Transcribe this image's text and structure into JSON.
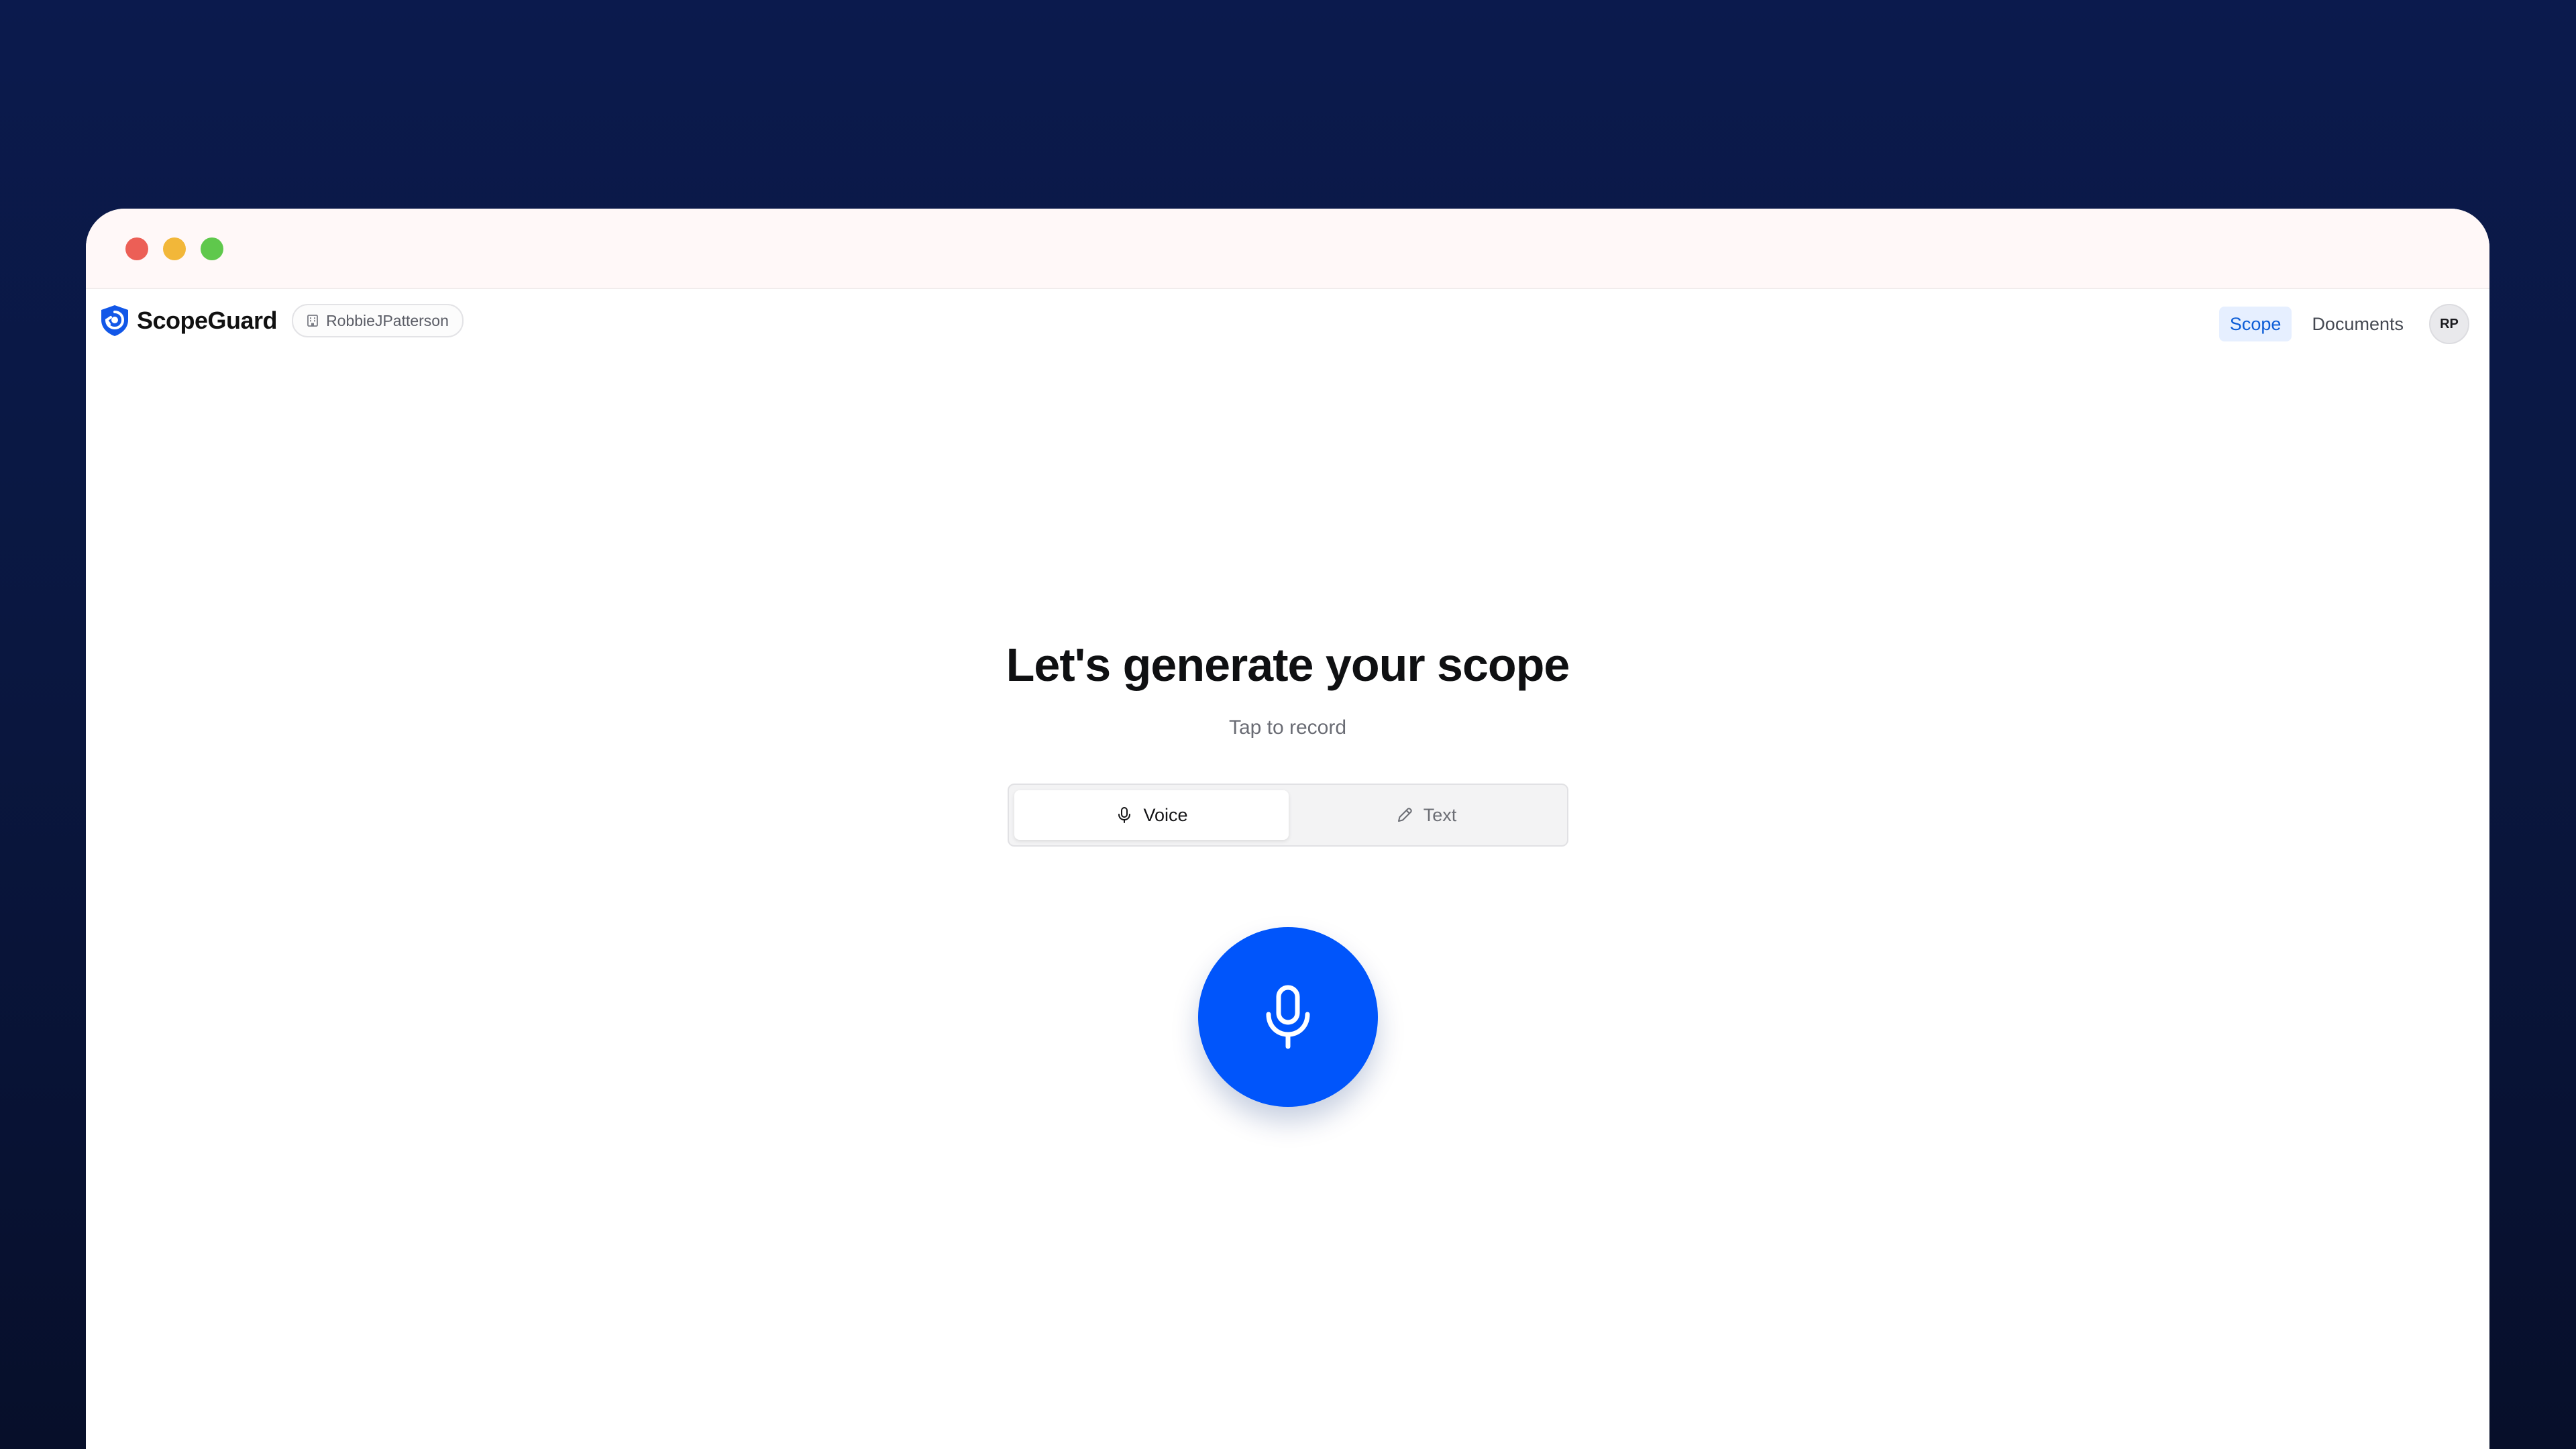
{
  "app": {
    "name": "ScopeGuard",
    "workspace": "RobbieJPatterson"
  },
  "nav": {
    "tabs": [
      {
        "label": "Scope",
        "active": true
      },
      {
        "label": "Documents",
        "active": false
      }
    ],
    "avatar_initials": "RP"
  },
  "main": {
    "title": "Let's generate your scope",
    "subtitle": "Tap to record",
    "mode_toggle": {
      "options": [
        {
          "label": "Voice",
          "icon": "microphone-icon",
          "selected": true
        },
        {
          "label": "Text",
          "icon": "pencil-icon",
          "selected": false
        }
      ]
    },
    "record_button": {
      "icon": "microphone-icon"
    }
  },
  "colors": {
    "accent": "#0055fb",
    "background": "#0b1a4d",
    "active_tab_bg": "#e6efff",
    "active_tab_text": "#0b5cd6"
  }
}
